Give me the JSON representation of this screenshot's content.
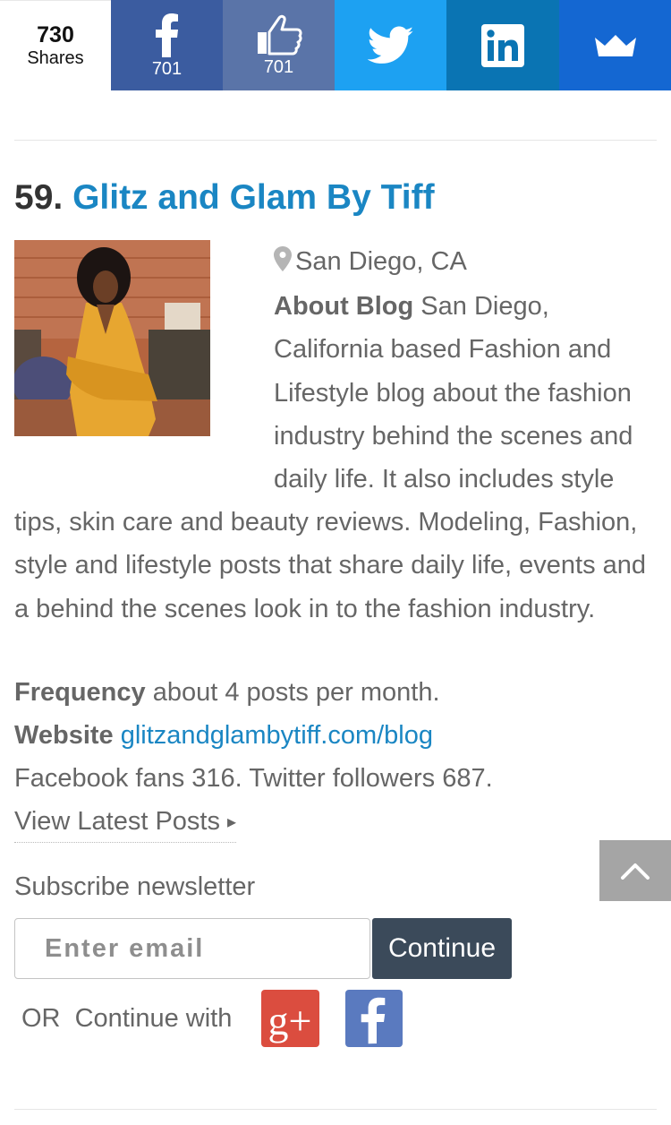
{
  "share_bar": {
    "total_count": "730",
    "total_label": "Shares",
    "facebook_count": "701",
    "like_count": "701",
    "icons": [
      "facebook-icon",
      "thumbs-up-icon",
      "twitter-icon",
      "linkedin-icon",
      "crown-icon"
    ],
    "colors": {
      "facebook": "#3b5ca0",
      "like": "#5a74a8",
      "twitter": "#1da1f2",
      "linkedin": "#0a74b3",
      "crown": "#1467d2"
    }
  },
  "entry": {
    "number": "59.",
    "title": "Glitz and Glam By Tiff",
    "location": "San Diego, CA",
    "about_label": "About Blog",
    "about_text": "San Diego, California based Fashion and Lifestyle blog about the fashion industry behind the scenes and daily life. It also includes style tips, skin care and beauty reviews. Modeling, Fashion, style and lifestyle posts that share daily life, events and a behind the scenes look in to the fashion industry.",
    "frequency_label": "Frequency",
    "frequency_value": "about 4 posts per month.",
    "website_label": "Website",
    "website_url": "glitzandglambytiff.com/blog",
    "social_stats": "Facebook fans 316. Twitter followers 687.",
    "view_latest": "View Latest Posts",
    "view_latest_arrow": "▸"
  },
  "newsletter": {
    "label": "Subscribe newsletter",
    "email_placeholder": "Enter email",
    "continue_label": "Continue",
    "or_text": "OR  Continue with",
    "google_plus_text": "g+"
  },
  "accent_colors": {
    "link": "#1a86c3",
    "button": "#3b4a5a",
    "google": "#db4d3f",
    "facebook": "#5a7abf"
  }
}
